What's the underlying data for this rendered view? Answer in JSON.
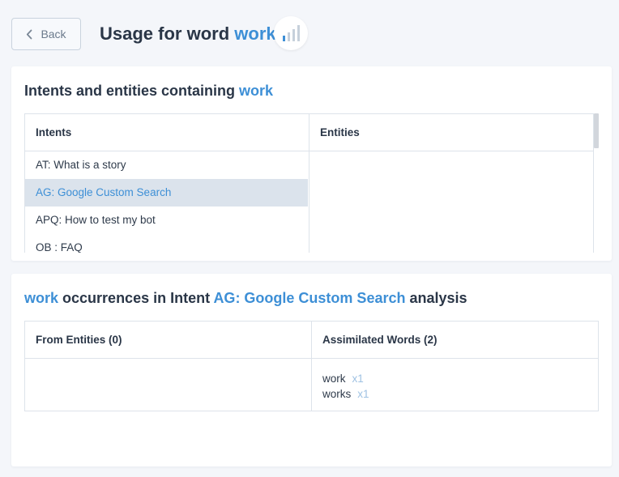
{
  "header": {
    "back_label": "Back",
    "title_prefix": "Usage for word",
    "word": "work"
  },
  "intents_card": {
    "title_prefix": "Intents and entities containing",
    "word": "work",
    "columns": {
      "intents": "Intents",
      "entities": "Entities"
    },
    "intents": [
      {
        "label": "AT: What is a story",
        "selected": false
      },
      {
        "label": "AG: Google Custom Search",
        "selected": true
      },
      {
        "label": "APQ: How to test my bot",
        "selected": false
      },
      {
        "label": "OB : FAQ",
        "selected": false
      }
    ]
  },
  "occurrences_card": {
    "word": "work",
    "title_middle": "occurrences in Intent",
    "intent": "AG: Google Custom Search",
    "title_suffix": "analysis",
    "columns": {
      "from_entities": "From Entities (0)",
      "assimilated_words": "Assimilated Words (2)"
    },
    "assimilated_words": [
      {
        "word": "work",
        "count": "x1"
      },
      {
        "word": "works",
        "count": "x1"
      }
    ]
  },
  "colors": {
    "accent": "#3d8fd6",
    "selected_row_bg": "#dbe3ec",
    "text": "#2a3647"
  }
}
